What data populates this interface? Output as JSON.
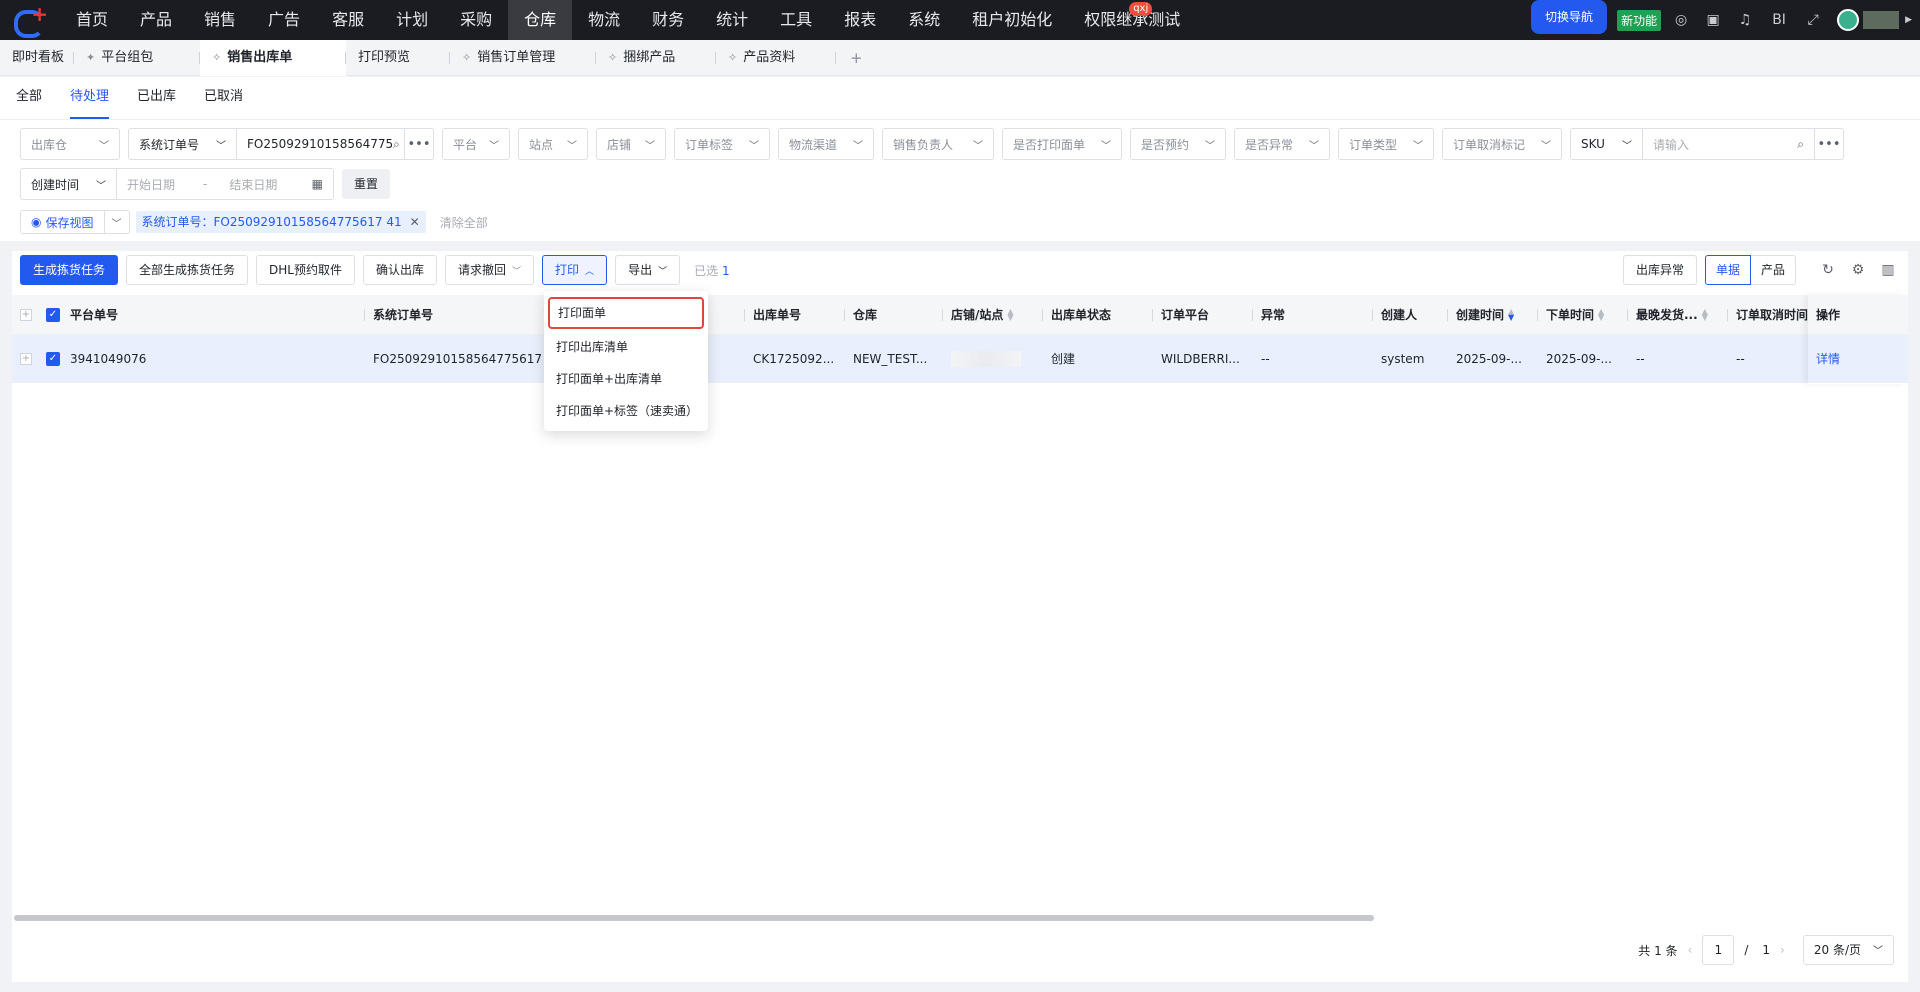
{
  "topnav": {
    "items": [
      "首页",
      "产品",
      "销售",
      "广告",
      "客服",
      "计划",
      "采购",
      "仓库",
      "物流",
      "财务",
      "统计",
      "工具",
      "报表",
      "系统",
      "租户初始化",
      "权限继承测试"
    ],
    "active_index": 7,
    "badge": "qxj",
    "switch_label": "切换导航",
    "new_feature_label": "新功能",
    "bi_label": "BI"
  },
  "tabs": [
    {
      "label": "即时看板",
      "pinned": false,
      "pin": "",
      "active": false
    },
    {
      "label": "平台组包",
      "pinned": true,
      "pin": "pin-icon",
      "active": false
    },
    {
      "label": "销售出库单",
      "pinned": true,
      "pin": "pin-outline-icon",
      "active": true
    },
    {
      "label": "打印预览",
      "pinned": false,
      "pin": "",
      "active": false
    },
    {
      "label": "销售订单管理",
      "pinned": true,
      "pin": "pin-outline-icon",
      "active": false
    },
    {
      "label": "捆绑产品",
      "pinned": true,
      "pin": "pin-outline-icon",
      "active": false
    },
    {
      "label": "产品资料",
      "pinned": true,
      "pin": "pin-outline-icon",
      "active": false
    }
  ],
  "add_tab": "+",
  "subtabs": [
    "全部",
    "待处理",
    "已出库",
    "已取消"
  ],
  "filters": {
    "warehouse_ph": "出库仓",
    "search_type": "系统订单号",
    "search_value": "FO25092910158564775",
    "platform": "平台",
    "site": "站点",
    "store": "店铺",
    "order_tag": "订单标签",
    "logistics": "物流渠道",
    "sales_owner": "销售负责人",
    "printed": "是否打印面单",
    "reserved": "是否预约",
    "abnormal": "是否异常",
    "order_type": "订单类型",
    "cancel_mark": "订单取消标记",
    "sku_type": "SKU",
    "sku_ph": "请输入",
    "time_type": "创建时间",
    "start_ph": "开始日期",
    "dash": "-",
    "end_ph": "结束日期",
    "reset": "重置",
    "save_view": "保存视图",
    "active_tag": "系统订单号：FO25092910158564775617 41",
    "clear_all": "清除全部"
  },
  "toolbar": {
    "gen_pick": "生成拣货任务",
    "gen_all_pick": "全部生成拣货任务",
    "dhl": "DHL预约取件",
    "confirm_out": "确认出库",
    "request_withdraw": "请求撤回",
    "print": "打印",
    "export": "导出",
    "selected_prefix": "已选",
    "selected_count": "1",
    "out_abnormal": "出库异常",
    "view_doc": "单据",
    "view_product": "产品"
  },
  "print_menu": [
    "打印面单",
    "打印出库清单",
    "打印面单+出库清单",
    "打印面单+标签（速卖通）"
  ],
  "table": {
    "headers": [
      "平台单号",
      "系统订单号",
      "",
      "出库单号",
      "仓库",
      "店铺/站点",
      "出库单状态",
      "订单平台",
      "异常",
      "创建人",
      "创建时间",
      "下单时间",
      "最晚发货...",
      "订单取消时间",
      "操作"
    ],
    "rows": [
      {
        "platform_no": "3941049076",
        "system_no": "FO25092910158564775617",
        "out_no": "CK1725092...",
        "warehouse": "NEW_TEST...",
        "status": "创建",
        "order_platform": "WILDBERRI...",
        "abnormal": "--",
        "creator": "system",
        "created": "2025-09-...",
        "ordered": "2025-09-...",
        "latest_ship": "--",
        "cancel_time": "--",
        "action": "详情"
      }
    ]
  },
  "pager": {
    "total": "共 1 条",
    "page": "1",
    "slash": "/",
    "pages": "1",
    "size": "20 条/页"
  }
}
